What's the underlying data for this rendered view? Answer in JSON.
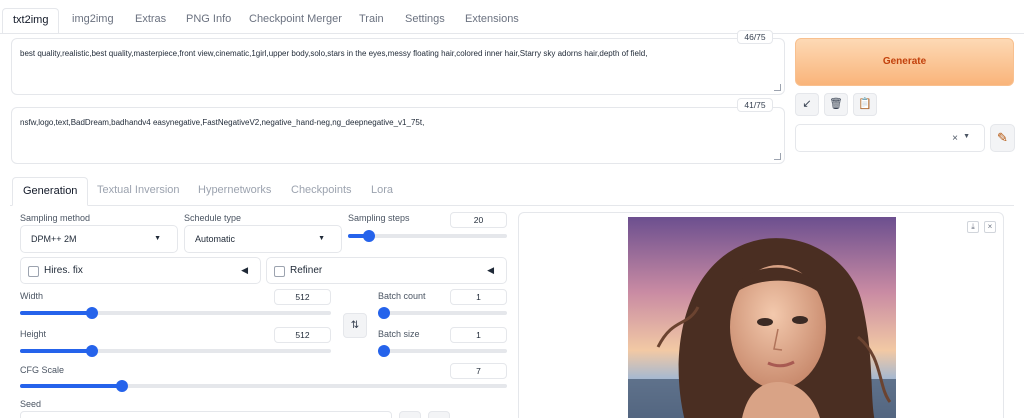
{
  "top_tabs": [
    "txt2img",
    "img2img",
    "Extras",
    "PNG Info",
    "Checkpoint Merger",
    "Train",
    "Settings",
    "Extensions"
  ],
  "prompt": {
    "text": "best quality,realistic,best quality,masterpiece,front view,cinematic,1girl,upper body,solo,stars in the eyes,messy floating hair,colored inner hair,Starry sky adorns hair,depth of field,",
    "token_count": "46/75"
  },
  "negative_prompt": {
    "text": "nsfw,logo,text,BadDream,badhandv4 easynegative,FastNegativeV2,negative_hand-neg,ng_deepnegative_v1_75t,",
    "token_count": "41/75"
  },
  "actions": {
    "generate_label": "Generate",
    "paste_icon": "↙",
    "trash_icon": "🗑",
    "clipboard_icon": "📋",
    "style_clear_icon": "×",
    "style_caret_icon": "▼",
    "edit_icon": "✎"
  },
  "sub_tabs": [
    "Generation",
    "Textual Inversion",
    "Hypernetworks",
    "Checkpoints",
    "Lora"
  ],
  "generation": {
    "sampling_method": {
      "label": "Sampling method",
      "value": "DPM++ 2M"
    },
    "schedule_type": {
      "label": "Schedule type",
      "value": "Automatic"
    },
    "sampling_steps": {
      "label": "Sampling steps",
      "value": "20",
      "fraction": 0.13
    },
    "hires_fix": {
      "label": "Hires. fix",
      "checked": false
    },
    "refiner": {
      "label": "Refiner",
      "checked": false
    },
    "width": {
      "label": "Width",
      "value": "512",
      "fraction": 0.23
    },
    "height": {
      "label": "Height",
      "value": "512",
      "fraction": 0.23
    },
    "batch_count": {
      "label": "Batch count",
      "value": "1",
      "fraction": 0.0
    },
    "batch_size": {
      "label": "Batch size",
      "value": "1",
      "fraction": 0.0
    },
    "cfg_scale": {
      "label": "CFG Scale",
      "value": "7",
      "fraction": 0.21
    },
    "seed": {
      "label": "Seed"
    },
    "swap_icon": "⇅",
    "collapse_icon": "◀",
    "caret_icon": "▼"
  },
  "gallery": {
    "download_icon": "⤓",
    "close_icon": "×"
  },
  "colors": {
    "accent": "#2563eb",
    "generate_text": "#c2410c",
    "generate_bg": "#f9b47a"
  }
}
